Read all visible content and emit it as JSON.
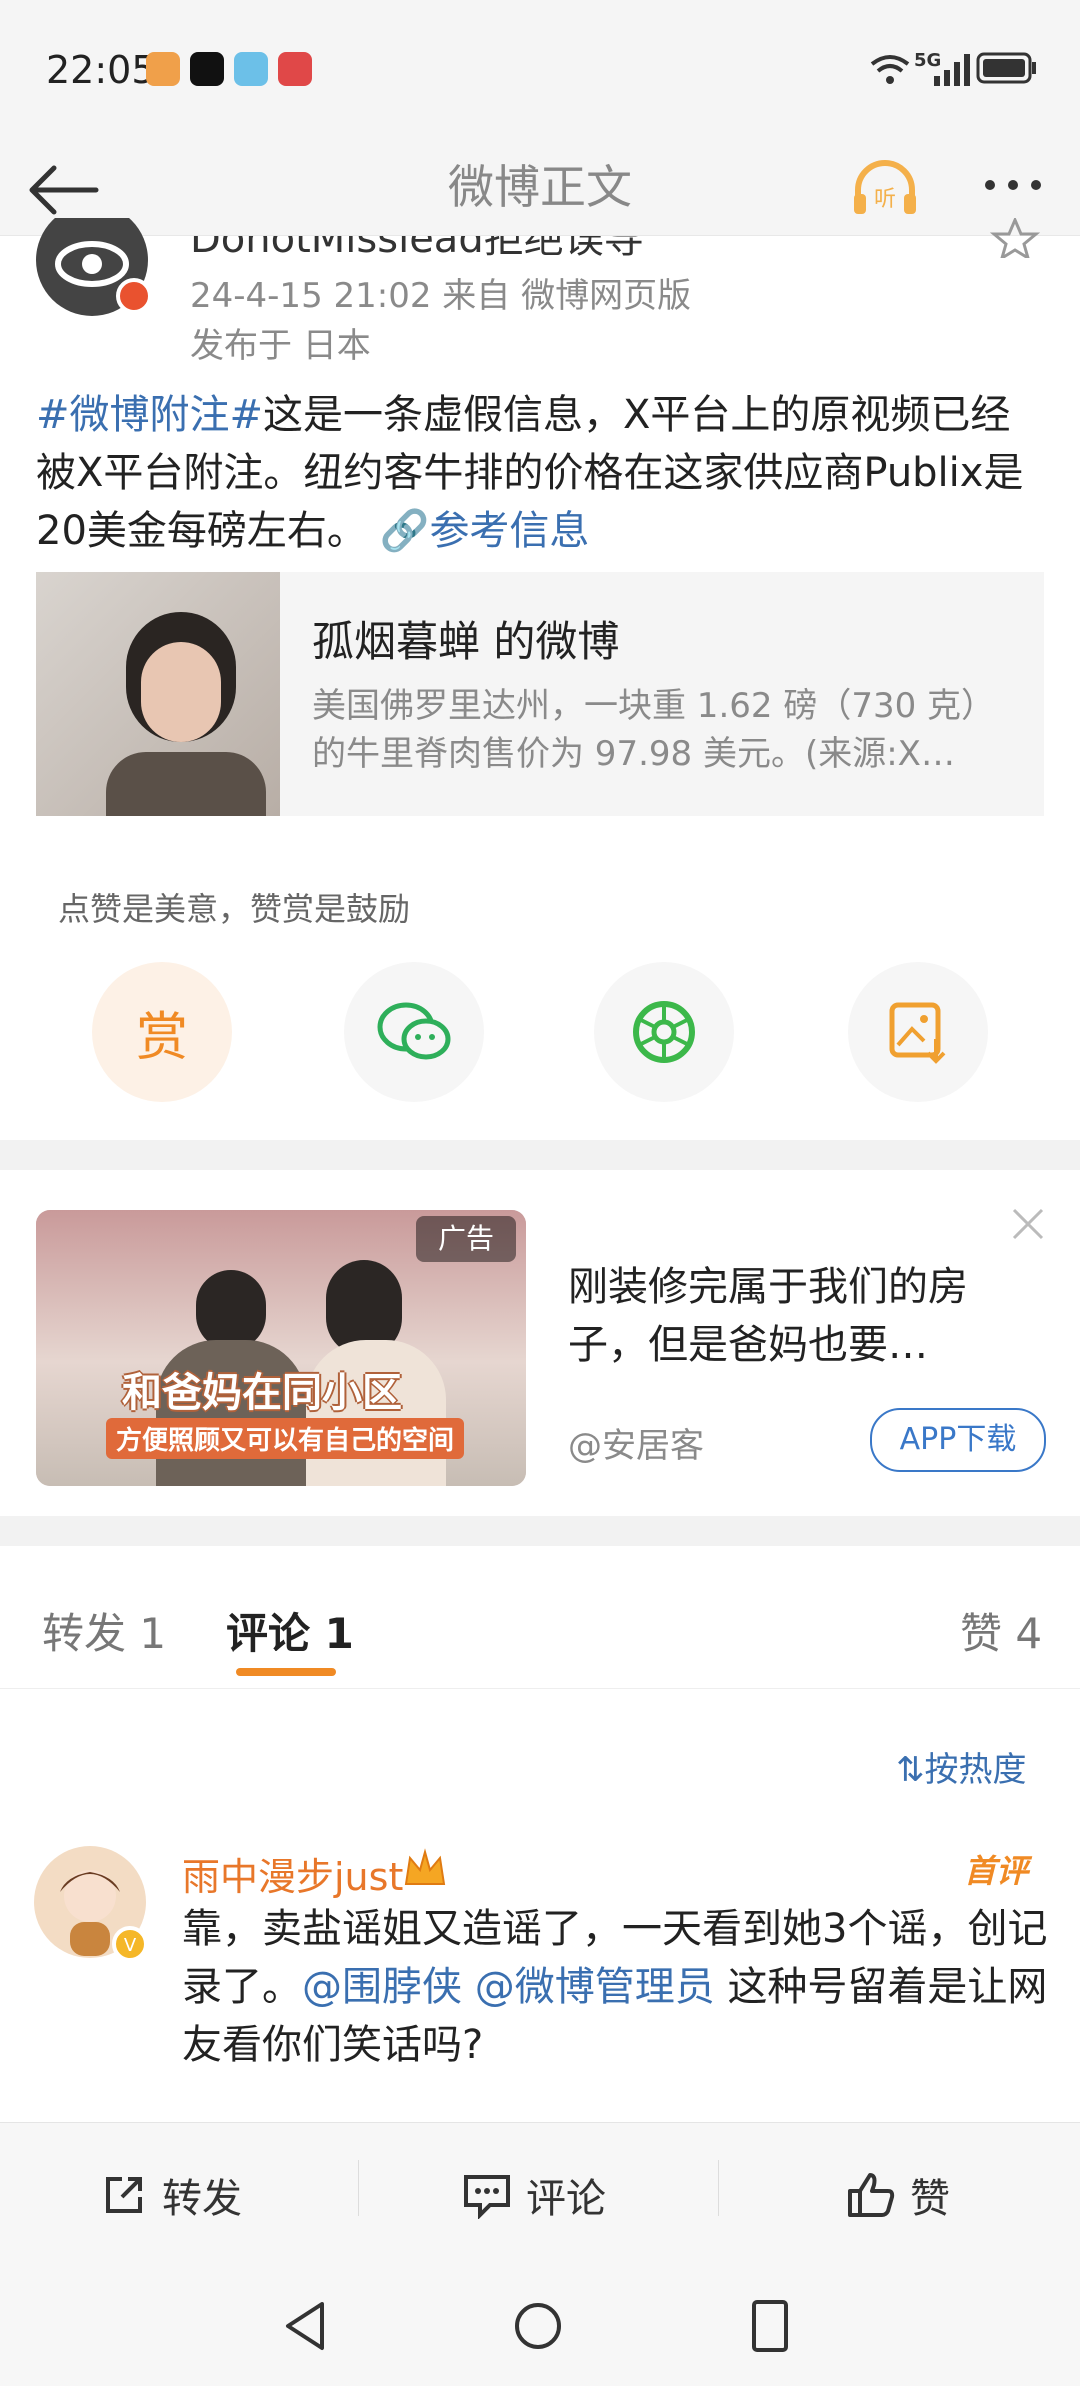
{
  "status": {
    "time": "22:05",
    "net": "5G"
  },
  "header": {
    "title": "微博正文"
  },
  "post": {
    "author_clip": "DonotMisslead拒绝误导",
    "meta": "24-4-15 21:02  来自 微博网页版",
    "location": "发布于 日本",
    "body_hashtag": "#微博附注#",
    "body_text": "这是一条虚假信息，X平台上的原视频已经被X平台附注。纽约客牛排的价格在这家供应商Publix是20美金每磅左右。",
    "ref_link": "参考信息",
    "quote_title": "孤烟暮蝉 的微博",
    "quote_text": "美国佛罗里达州，一块重 1.62 磅（730 克）的牛里脊肉售价为 97.98 美元。(来源:X…"
  },
  "reward": {
    "hint": "点赞是美意，赞赏是鼓励",
    "reward_label": "赏"
  },
  "ad": {
    "badge": "广告",
    "image_title": "和爸妈在同小区",
    "image_sub": "方便照顾又可以有自己的空间",
    "text": "刚装修完属于我们的房子，但是爸妈也要…",
    "source": "@安居客",
    "cta": "APP下载"
  },
  "tabs": {
    "repost": "转发 1",
    "comment": "评论 1",
    "like": "赞 4"
  },
  "sort": "按热度",
  "comment": {
    "user": "雨中漫步just",
    "badge": "首评",
    "text_a": "靠，卖盐谣姐又造谣了，一天看到她3个谣，创记录了。",
    "mention1": "@围脖侠",
    "mention2": "@微博管理员",
    "text_b": "这种号留着是让网友看你们笑话吗?"
  },
  "bottom": {
    "repost": "转发",
    "comment": "评论",
    "like": "赞"
  },
  "colors": {
    "accent_orange": "#f08a24",
    "link_blue": "#3a6fb0"
  }
}
